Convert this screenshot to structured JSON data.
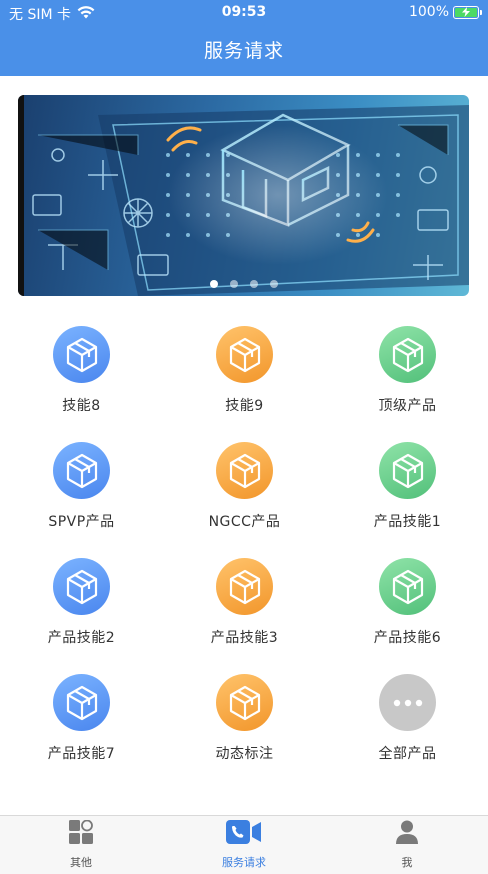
{
  "status_bar": {
    "carrier": "无 SIM 卡",
    "time": "09:53",
    "battery": "100%"
  },
  "header": {
    "title": "服务请求"
  },
  "banner": {
    "page_count": 4,
    "active_page": 1
  },
  "services": [
    {
      "label": "技能8",
      "color": "blue",
      "icon": "cube-icon"
    },
    {
      "label": "技能9",
      "color": "orange",
      "icon": "cube-icon"
    },
    {
      "label": "顶级产品",
      "color": "green",
      "icon": "cube-icon"
    },
    {
      "label": "SPVP产品",
      "color": "blue",
      "icon": "cube-icon"
    },
    {
      "label": "NGCC产品",
      "color": "orange",
      "icon": "cube-icon"
    },
    {
      "label": "产品技能1",
      "color": "green",
      "icon": "cube-icon"
    },
    {
      "label": "产品技能2",
      "color": "blue",
      "icon": "cube-icon"
    },
    {
      "label": "产品技能3",
      "color": "orange",
      "icon": "cube-icon"
    },
    {
      "label": "产品技能6",
      "color": "green",
      "icon": "cube-icon"
    },
    {
      "label": "产品技能7",
      "color": "blue",
      "icon": "cube-icon"
    },
    {
      "label": "动态标注",
      "color": "orange",
      "icon": "cube-icon"
    },
    {
      "label": "全部产品",
      "color": "gray",
      "icon": "more-icon"
    }
  ],
  "tabbar": {
    "tabs": [
      {
        "label": "其他",
        "icon": "apps-icon",
        "active": false
      },
      {
        "label": "服务请求",
        "icon": "video-call-icon",
        "active": true
      },
      {
        "label": "我",
        "icon": "user-icon",
        "active": false
      }
    ]
  },
  "colors": {
    "primary": "#4a90e8",
    "blue_icon": "#4a86ee",
    "orange_icon": "#f2962b",
    "green_icon": "#52c07a",
    "gray_icon": "#c8c8c8",
    "tab_active": "#3b7fe0"
  }
}
